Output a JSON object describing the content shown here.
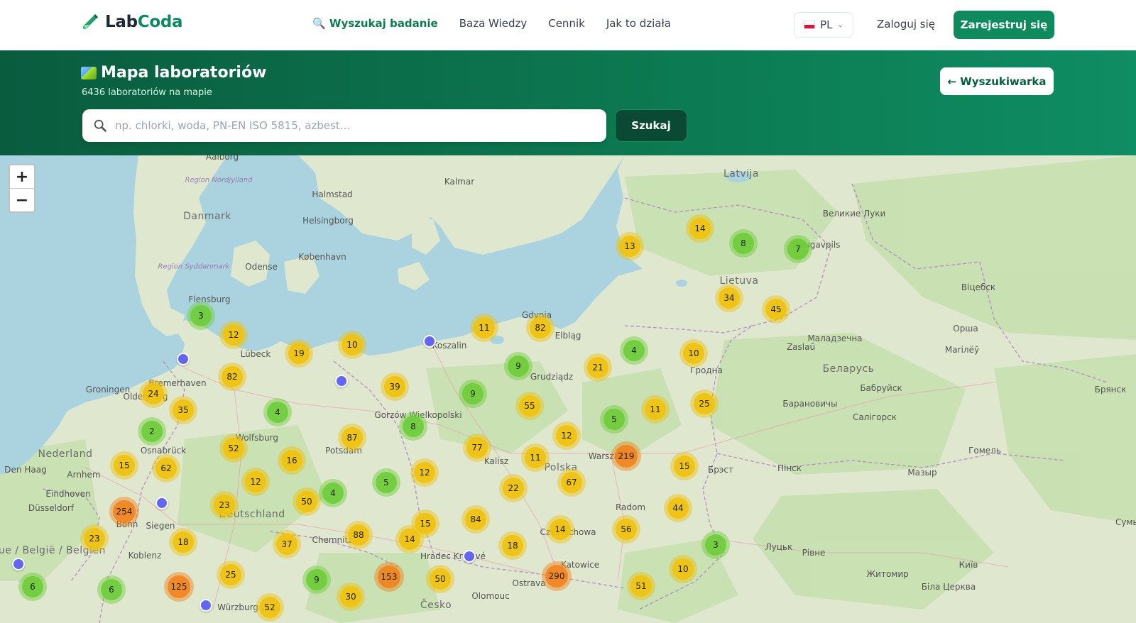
{
  "header": {
    "logo_lab": "Lab",
    "logo_coda": "Coda",
    "nav": [
      {
        "label": "🔍 Wyszukaj badanie",
        "active": true
      },
      {
        "label": "Baza Wiedzy",
        "active": false
      },
      {
        "label": "Cennik",
        "active": false
      },
      {
        "label": "Jak to działa",
        "active": false
      }
    ],
    "language": "PL",
    "login": "Zaloguj się",
    "register": "Zarejestruj się"
  },
  "banner": {
    "title": "Mapa laboratoriów",
    "subtitle": "6436 laboratoriów na mapie",
    "back_button": "← Wyszukiwarka",
    "search_placeholder": "np. chlorki, woda, PN-EN ISO 5815, azbest...",
    "search_value": "",
    "search_button": "Szukaj"
  },
  "map": {
    "zoom_in": "+",
    "zoom_out": "−",
    "places": [
      {
        "name": "Aalborg",
        "kind": "city"
      },
      {
        "name": "Danmark",
        "kind": "country"
      },
      {
        "name": "Region Nordjylland",
        "kind": "region"
      },
      {
        "name": "Halmstad",
        "kind": "city"
      },
      {
        "name": "Kalmar",
        "kind": "city"
      },
      {
        "name": "Helsingborg",
        "kind": "city"
      },
      {
        "name": "København",
        "kind": "city"
      },
      {
        "name": "Odense",
        "kind": "city"
      },
      {
        "name": "Region Syddanmark",
        "kind": "region"
      },
      {
        "name": "Flensburg",
        "kind": "city"
      },
      {
        "name": "Lübeck",
        "kind": "city"
      },
      {
        "name": "Koszalin",
        "kind": "city"
      },
      {
        "name": "Gdynia",
        "kind": "city"
      },
      {
        "name": "Elbląg",
        "kind": "city"
      },
      {
        "name": "Grudziądz",
        "kind": "city"
      },
      {
        "name": "Latvija",
        "kind": "country"
      },
      {
        "name": "Lietuva",
        "kind": "country"
      },
      {
        "name": "Daugavpils",
        "kind": "city"
      },
      {
        "name": "Гродна",
        "kind": "city"
      },
      {
        "name": "Беларусь",
        "kind": "country"
      },
      {
        "name": "Вiцебск",
        "kind": "city"
      },
      {
        "name": "Маладзечна",
        "kind": "city"
      },
      {
        "name": "Mariлёў",
        "kind": "city"
      },
      {
        "name": "Брянск",
        "kind": "city"
      },
      {
        "name": "Groningen",
        "kind": "city"
      },
      {
        "name": "Bremerhaven",
        "kind": "city"
      },
      {
        "name": "Oldenburg",
        "kind": "city"
      },
      {
        "name": "Osnabrück",
        "kind": "city"
      },
      {
        "name": "Wolfsburg",
        "kind": "city"
      },
      {
        "name": "Potsdam",
        "kind": "city"
      },
      {
        "name": "Gorzów Wielkopolski",
        "kind": "city"
      },
      {
        "name": "Nederland",
        "kind": "country"
      },
      {
        "name": "Den Haag",
        "kind": "city"
      },
      {
        "name": "Arnhem",
        "kind": "city"
      },
      {
        "name": "Eindhoven",
        "kind": "city"
      },
      {
        "name": "Düsseldorf",
        "kind": "city"
      },
      {
        "name": "Bonn",
        "kind": "city"
      },
      {
        "name": "Siegen",
        "kind": "city"
      },
      {
        "name": "Koblenz",
        "kind": "city"
      },
      {
        "name": "Belgique / België / Belgien",
        "kind": "country"
      },
      {
        "name": "Deutschland",
        "kind": "country"
      },
      {
        "name": "Chemnitz",
        "kind": "city"
      },
      {
        "name": "Kalisz",
        "kind": "city"
      },
      {
        "name": "Polska",
        "kind": "country"
      },
      {
        "name": "Warszawa",
        "kind": "city"
      },
      {
        "name": "Radom",
        "kind": "city"
      },
      {
        "name": "Częstochowa",
        "kind": "city"
      },
      {
        "name": "Katowice",
        "kind": "city"
      },
      {
        "name": "Ostrava",
        "kind": "city"
      },
      {
        "name": "Olomouc",
        "kind": "city"
      },
      {
        "name": "Hradec Králové",
        "kind": "city"
      },
      {
        "name": "Česko",
        "kind": "country"
      },
      {
        "name": "Würzburg",
        "kind": "city"
      },
      {
        "name": "Брэст",
        "kind": "city"
      },
      {
        "name": "Пiнск",
        "kind": "city"
      },
      {
        "name": "Гомель",
        "kind": "city"
      },
      {
        "name": "Мазыр",
        "kind": "city"
      },
      {
        "name": "Луцьк",
        "kind": "city"
      },
      {
        "name": "Рiвне",
        "kind": "city"
      },
      {
        "name": "Житомир",
        "kind": "city"
      },
      {
        "name": "Київ",
        "kind": "city"
      },
      {
        "name": "Біла Церква",
        "kind": "city"
      },
      {
        "name": "Великие Луки",
        "kind": "city"
      },
      {
        "name": "Орша",
        "kind": "city"
      },
      {
        "name": "Бабруйск",
        "kind": "city"
      },
      {
        "name": "Барановичы",
        "kind": "city"
      },
      {
        "name": "Салiгорск",
        "kind": "city"
      },
      {
        "name": "Сумы",
        "kind": "city"
      },
      {
        "name": "Zaslaŭ",
        "kind": "city"
      }
    ],
    "clusters": [
      {
        "count": 3,
        "level": "small"
      },
      {
        "count": 12,
        "level": "medium"
      },
      {
        "count": 19,
        "level": "medium"
      },
      {
        "count": 10,
        "level": "medium"
      },
      {
        "count": 82,
        "level": "medium"
      },
      {
        "count": 24,
        "level": "medium"
      },
      {
        "count": 35,
        "level": "medium"
      },
      {
        "count": 4,
        "level": "small"
      },
      {
        "count": 2,
        "level": "small"
      },
      {
        "count": 52,
        "level": "medium"
      },
      {
        "count": 87,
        "level": "medium"
      },
      {
        "count": 39,
        "level": "medium"
      },
      {
        "count": 8,
        "level": "small"
      },
      {
        "count": 9,
        "level": "small"
      },
      {
        "count": 11,
        "level": "medium"
      },
      {
        "count": 82,
        "level": "medium"
      },
      {
        "count": 9,
        "level": "small"
      },
      {
        "count": 21,
        "level": "medium"
      },
      {
        "count": 4,
        "level": "small"
      },
      {
        "count": 10,
        "level": "medium"
      },
      {
        "count": 13,
        "level": "medium"
      },
      {
        "count": 14,
        "level": "medium"
      },
      {
        "count": 8,
        "level": "small"
      },
      {
        "count": 7,
        "level": "small"
      },
      {
        "count": 34,
        "level": "medium"
      },
      {
        "count": 45,
        "level": "medium"
      },
      {
        "count": 55,
        "level": "medium"
      },
      {
        "count": 5,
        "level": "small"
      },
      {
        "count": 11,
        "level": "medium"
      },
      {
        "count": 25,
        "level": "medium"
      },
      {
        "count": 15,
        "level": "medium"
      },
      {
        "count": 62,
        "level": "medium"
      },
      {
        "count": 16,
        "level": "medium"
      },
      {
        "count": 12,
        "level": "medium"
      },
      {
        "count": 77,
        "level": "medium"
      },
      {
        "count": 12,
        "level": "medium"
      },
      {
        "count": 11,
        "level": "medium"
      },
      {
        "count": 219,
        "level": "large"
      },
      {
        "count": 15,
        "level": "medium"
      },
      {
        "count": 254,
        "level": "large"
      },
      {
        "count": 23,
        "level": "medium"
      },
      {
        "count": 50,
        "level": "medium"
      },
      {
        "count": 4,
        "level": "small"
      },
      {
        "count": 5,
        "level": "small"
      },
      {
        "count": 12,
        "level": "medium"
      },
      {
        "count": 22,
        "level": "medium"
      },
      {
        "count": 67,
        "level": "medium"
      },
      {
        "count": 44,
        "level": "medium"
      },
      {
        "count": 23,
        "level": "medium"
      },
      {
        "count": 18,
        "level": "medium"
      },
      {
        "count": 37,
        "level": "medium"
      },
      {
        "count": 88,
        "level": "medium"
      },
      {
        "count": 14,
        "level": "medium"
      },
      {
        "count": 15,
        "level": "medium"
      },
      {
        "count": 84,
        "level": "medium"
      },
      {
        "count": 18,
        "level": "medium"
      },
      {
        "count": 14,
        "level": "medium"
      },
      {
        "count": 56,
        "level": "medium"
      },
      {
        "count": 3,
        "level": "small"
      },
      {
        "count": 6,
        "level": "small"
      },
      {
        "count": 6,
        "level": "small"
      },
      {
        "count": 125,
        "level": "large"
      },
      {
        "count": 25,
        "level": "medium"
      },
      {
        "count": 9,
        "level": "small"
      },
      {
        "count": 153,
        "level": "large"
      },
      {
        "count": 50,
        "level": "medium"
      },
      {
        "count": 30,
        "level": "medium"
      },
      {
        "count": 52,
        "level": "medium"
      },
      {
        "count": 290,
        "level": "large"
      },
      {
        "count": 10,
        "level": "medium"
      },
      {
        "count": 51,
        "level": "medium"
      }
    ],
    "colors": {
      "water": "#aad3df",
      "land": "#dfe8cf",
      "forest": "#b8d8a4",
      "cluster_small": "#6ecc39",
      "cluster_medium": "#f0c20c",
      "cluster_large": "#f18017",
      "pin": "#6366f1"
    }
  }
}
